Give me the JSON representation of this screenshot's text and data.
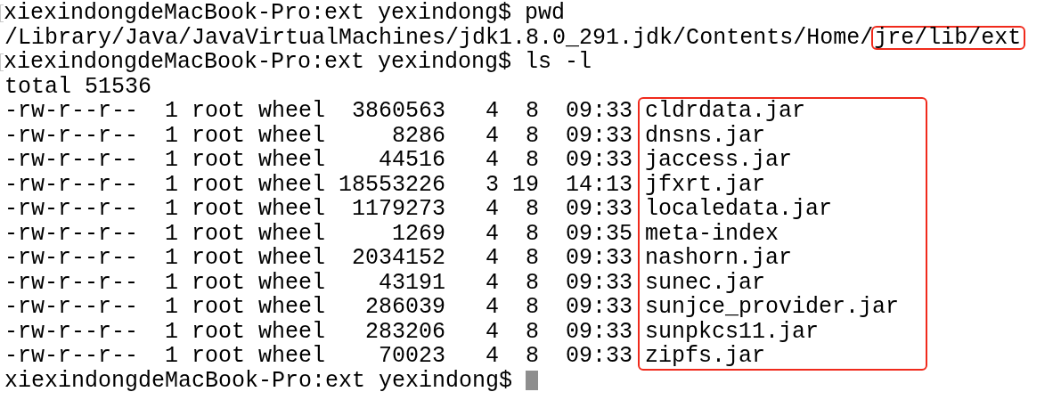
{
  "terminal": {
    "lines": [
      {
        "kind": "prompt",
        "text": "xiexindongdeMacBook-Pro:ext yexindong$ pwd",
        "marked": true,
        "cursor": false
      },
      {
        "kind": "output",
        "segments": [
          {
            "text": "/Library/Java/JavaVirtualMachines/jdk1.8.0_291.jdk/Contents/Home/",
            "highlighted": false
          },
          {
            "text": "jre/lib/ext",
            "highlighted": true
          }
        ]
      },
      {
        "kind": "prompt",
        "text": "xiexindongdeMacBook-Pro:ext yexindong$ ls -l",
        "marked": true,
        "cursor": false
      },
      {
        "kind": "output",
        "segments": [
          {
            "text": "total 51536",
            "highlighted": false
          }
        ]
      },
      {
        "kind": "listing",
        "names_highlighted": true,
        "rows": [
          {
            "permissions": "-rw-r--r--",
            "links": "1",
            "owner": "root",
            "group": "wheel",
            "size": "3860563",
            "month": "4",
            "day": "8",
            "time": "09:33",
            "name": "cldrdata.jar"
          },
          {
            "permissions": "-rw-r--r--",
            "links": "1",
            "owner": "root",
            "group": "wheel",
            "size": "8286",
            "month": "4",
            "day": "8",
            "time": "09:33",
            "name": "dnsns.jar"
          },
          {
            "permissions": "-rw-r--r--",
            "links": "1",
            "owner": "root",
            "group": "wheel",
            "size": "44516",
            "month": "4",
            "day": "8",
            "time": "09:33",
            "name": "jaccess.jar"
          },
          {
            "permissions": "-rw-r--r--",
            "links": "1",
            "owner": "root",
            "group": "wheel",
            "size": "18553226",
            "month": "3",
            "day": "19",
            "time": "14:13",
            "name": "jfxrt.jar"
          },
          {
            "permissions": "-rw-r--r--",
            "links": "1",
            "owner": "root",
            "group": "wheel",
            "size": "1179273",
            "month": "4",
            "day": "8",
            "time": "09:33",
            "name": "localedata.jar"
          },
          {
            "permissions": "-rw-r--r--",
            "links": "1",
            "owner": "root",
            "group": "wheel",
            "size": "1269",
            "month": "4",
            "day": "8",
            "time": "09:35",
            "name": "meta-index"
          },
          {
            "permissions": "-rw-r--r--",
            "links": "1",
            "owner": "root",
            "group": "wheel",
            "size": "2034152",
            "month": "4",
            "day": "8",
            "time": "09:33",
            "name": "nashorn.jar"
          },
          {
            "permissions": "-rw-r--r--",
            "links": "1",
            "owner": "root",
            "group": "wheel",
            "size": "43191",
            "month": "4",
            "day": "8",
            "time": "09:33",
            "name": "sunec.jar"
          },
          {
            "permissions": "-rw-r--r--",
            "links": "1",
            "owner": "root",
            "group": "wheel",
            "size": "286039",
            "month": "4",
            "day": "8",
            "time": "09:33",
            "name": "sunjce_provider.jar"
          },
          {
            "permissions": "-rw-r--r--",
            "links": "1",
            "owner": "root",
            "group": "wheel",
            "size": "283206",
            "month": "4",
            "day": "8",
            "time": "09:33",
            "name": "sunpkcs11.jar"
          },
          {
            "permissions": "-rw-r--r--",
            "links": "1",
            "owner": "root",
            "group": "wheel",
            "size": "70023",
            "month": "4",
            "day": "8",
            "time": "09:33",
            "name": "zipfs.jar"
          }
        ]
      },
      {
        "kind": "prompt",
        "text": "xiexindongdeMacBook-Pro:ext yexindong$",
        "marked": false,
        "cursor": true
      }
    ]
  }
}
